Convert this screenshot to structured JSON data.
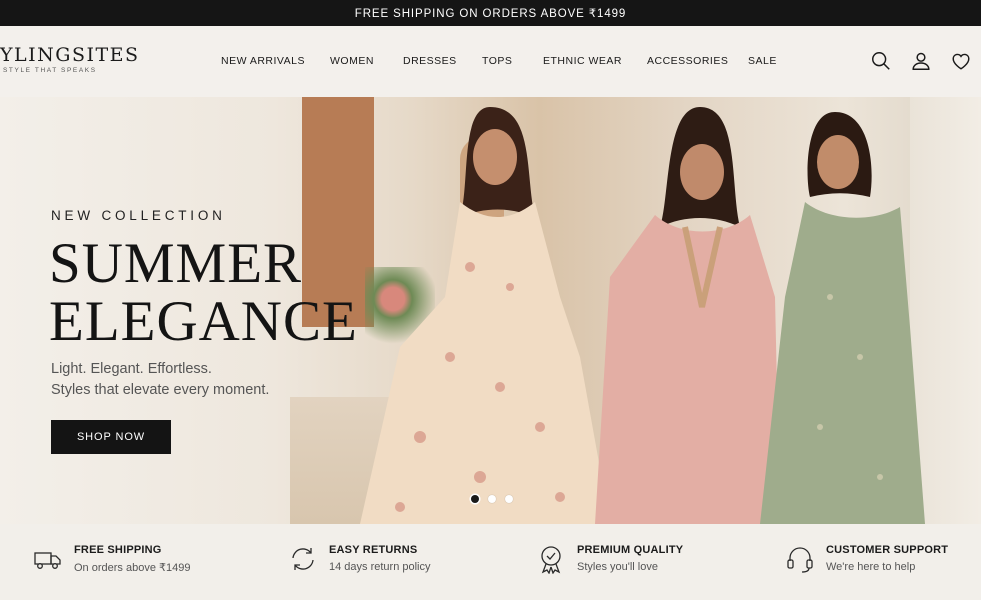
{
  "announcement": "FREE SHIPPING ON ORDERS ABOVE ₹1499",
  "brand": {
    "name": "YLINGSITES",
    "tagline": "STYLE THAT SPEAKS"
  },
  "nav": {
    "items": [
      "NEW ARRIVALS",
      "WOMEN",
      "DRESSES",
      "TOPS",
      "ETHNIC WEAR",
      "ACCESSORIES",
      "SALE"
    ],
    "icons": [
      "search-icon",
      "user-icon",
      "heart-icon"
    ]
  },
  "hero": {
    "eyebrow": "NEW COLLECTION",
    "headline_line1": "SUMMER",
    "headline_line2": "ELEGANCE",
    "sub_line1": "Light. Elegant. Effortless.",
    "sub_line2": "Styles that elevate every moment.",
    "cta": "SHOP NOW",
    "slides": 3,
    "active_slide": 1
  },
  "features": [
    {
      "icon": "truck-icon",
      "title": "FREE SHIPPING",
      "subtitle": "On orders above ₹1499"
    },
    {
      "icon": "returns-icon",
      "title": "EASY RETURNS",
      "subtitle": "14 days return policy"
    },
    {
      "icon": "quality-badge-icon",
      "title": "PREMIUM QUALITY",
      "subtitle": "Styles you'll love"
    },
    {
      "icon": "headset-icon",
      "title": "CUSTOMER SUPPORT",
      "subtitle": "We're here to help"
    }
  ],
  "colors": {
    "topbar": "#151515",
    "accent": "#141414",
    "background": "#f3f0ec"
  }
}
